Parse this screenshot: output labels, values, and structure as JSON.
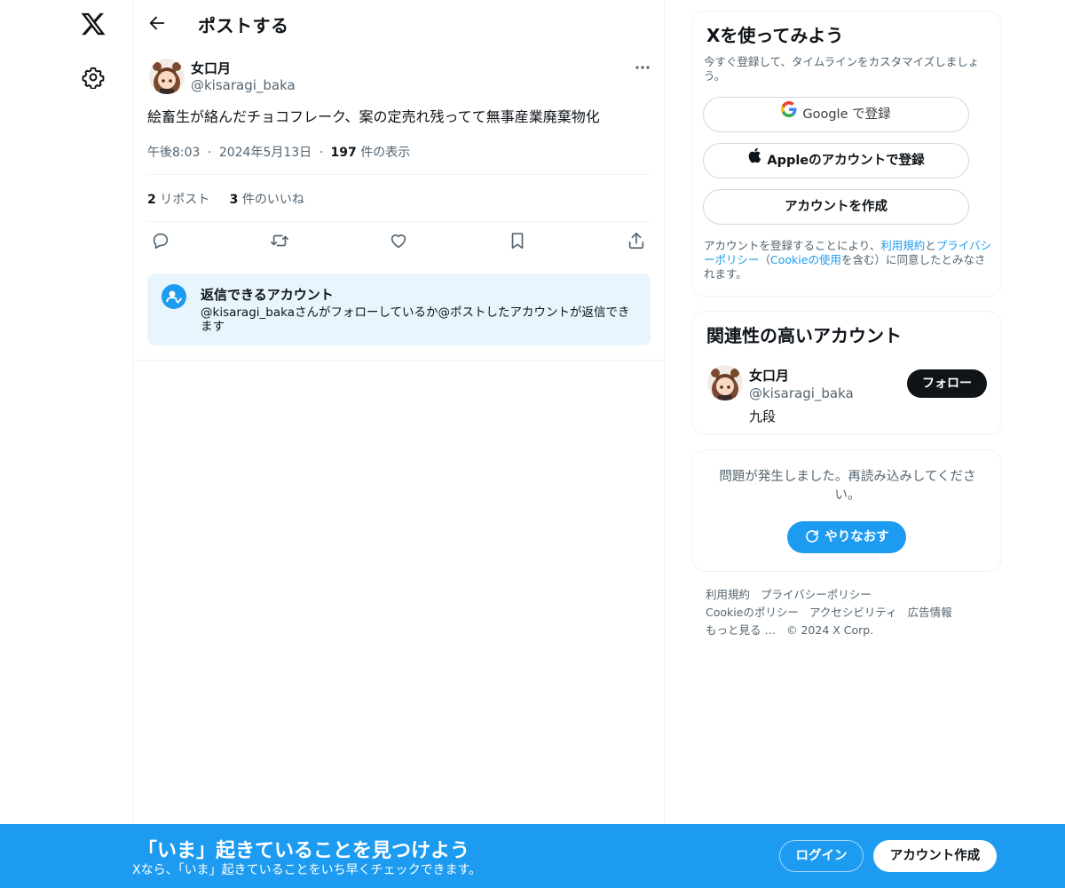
{
  "nav": {
    "logo_icon": "x-logo-icon",
    "settings_icon": "gear-icon"
  },
  "header": {
    "back_icon": "arrow-left-icon",
    "title": "ポストする"
  },
  "post": {
    "author_name": "女口月",
    "author_handle": "@kisaragi_baka",
    "more_icon": "more-dots-icon",
    "text": "絵畜生が絡んだチョコフレーク、案の定売れ残ってて無事産業廃棄物化",
    "time": "午後8:03",
    "date": "2024年5月13日",
    "sep": "·",
    "views_count": "197",
    "views_label": "件の表示",
    "reposts_count": "2",
    "reposts_label": "リポスト",
    "likes_count": "3",
    "likes_label": "件のいいね",
    "actions": [
      "reply-icon",
      "repost-icon",
      "like-icon",
      "bookmark-icon",
      "share-icon"
    ]
  },
  "reply_restriction": {
    "title": "返信できるアカウント",
    "text": "@kisaragi_bakaさんがフォローしているか@ポストしたアカウントが返信できます"
  },
  "signup_card": {
    "title": "Xを使ってみよう",
    "subtitle": "今すぐ登録して、タイムラインをカスタマイズしましょう。",
    "google_label": "Google で登録",
    "apple_label": "Appleのアカウントで登録",
    "create_label": "アカウントを作成",
    "terms_prefix": "アカウントを登録することにより、",
    "terms_link": "利用規約",
    "terms_and": "と",
    "privacy_link": "プライバシーポリシー",
    "paren_open": "（",
    "cookie_link": "Cookieの使用",
    "terms_suffix": "を含む）に同意したとみなされます。"
  },
  "related": {
    "title": "関連性の高いアカウント",
    "name": "女口月",
    "handle": "@kisaragi_baka",
    "bio": "九段",
    "follow_label": "フォロー"
  },
  "error_card": {
    "message": "問題が発生しました。再読み込みしてください。",
    "retry_label": "やりなおす"
  },
  "footer": {
    "terms": "利用規約",
    "privacy": "プライバシーポリシー",
    "cookie": "Cookieのポリシー",
    "accessibility": "アクセシビリティ",
    "ads": "広告情報",
    "more": "もっと見る …",
    "copyright": "© 2024 X Corp."
  },
  "banner": {
    "title": "「いま」起きていることを見つけよう",
    "subtitle": "Xなら、「いま」起きていることをいち早くチェックできます。",
    "login_label": "ログイン",
    "signup_label": "アカウント作成"
  },
  "colors": {
    "accent": "#1d9bf0",
    "text": "#0f1419",
    "muted": "#536471",
    "reply_bg": "#e8f5fd"
  }
}
